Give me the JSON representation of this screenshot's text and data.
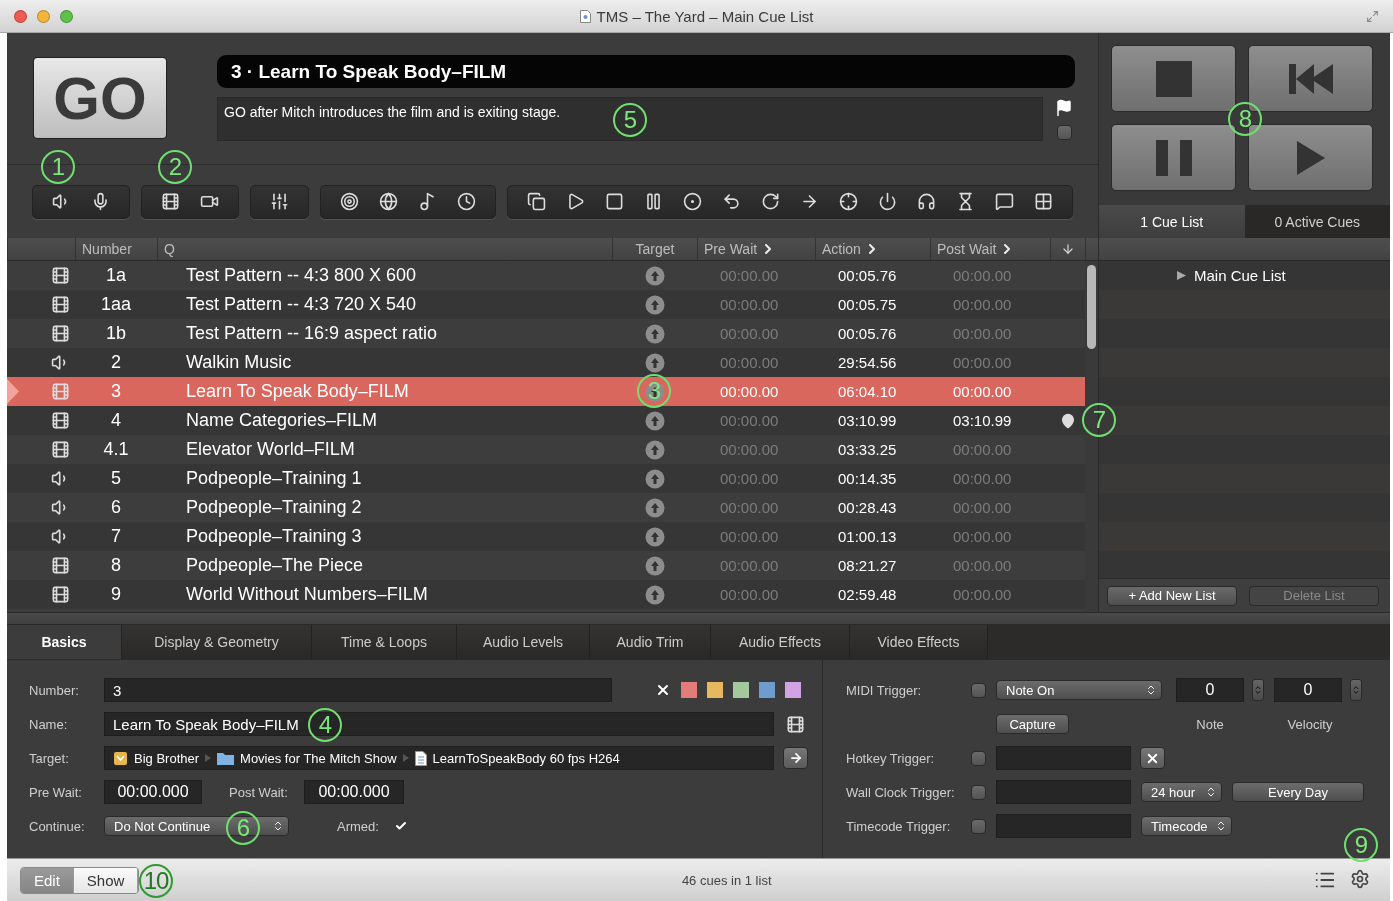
{
  "window": {
    "title": "TMS – The Yard – Main Cue List"
  },
  "go_button": {
    "label": "GO"
  },
  "current_cue": {
    "title": "3 · Learn To Speak Body–FILM",
    "notes": "GO after Mitch introduces the film and is exiting stage.",
    "flagged": false
  },
  "panel_tabs": [
    {
      "label": "1 Cue List",
      "selected": true
    },
    {
      "label": "0 Active Cues",
      "selected": false
    }
  ],
  "cue_lists": [
    {
      "name": "Main Cue List",
      "expanded": false
    }
  ],
  "list_buttons": [
    {
      "label": "+ Add New List",
      "disabled": false
    },
    {
      "label": "Delete List",
      "disabled": true
    }
  ],
  "table": {
    "columns": [
      {
        "label": "Number",
        "arrow": false
      },
      {
        "label": "Q",
        "arrow": false
      },
      {
        "label": "Target",
        "arrow": false
      },
      {
        "label": "Pre Wait",
        "arrow": true
      },
      {
        "label": "Action",
        "arrow": true
      },
      {
        "label": "Post Wait",
        "arrow": true
      }
    ],
    "rows": [
      {
        "kind": "video",
        "number": "1a",
        "q": "Test Pattern -- 4:3 800 X 600",
        "pre_wait": "00:00.00",
        "pre_wait_dim": true,
        "action": "00:05.76",
        "post_wait": "00:00.00",
        "post_wait_dim": true,
        "selected": false,
        "marker": false
      },
      {
        "kind": "video",
        "number": "1aa",
        "q": "Test Pattern -- 4:3 720 X 540",
        "pre_wait": "00:00.00",
        "pre_wait_dim": true,
        "action": "00:05.75",
        "post_wait": "00:00.00",
        "post_wait_dim": true,
        "selected": false,
        "marker": false
      },
      {
        "kind": "video",
        "number": "1b",
        "q": "Test Pattern -- 16:9 aspect ratio",
        "pre_wait": "00:00.00",
        "pre_wait_dim": true,
        "action": "00:05.76",
        "post_wait": "00:00.00",
        "post_wait_dim": true,
        "selected": false,
        "marker": false
      },
      {
        "kind": "audio",
        "number": "2",
        "q": "Walkin Music",
        "pre_wait": "00:00.00",
        "pre_wait_dim": true,
        "action": "29:54.56",
        "post_wait": "00:00.00",
        "post_wait_dim": true,
        "selected": false,
        "marker": false
      },
      {
        "kind": "video",
        "number": "3",
        "q": "Learn To Speak Body–FILM",
        "pre_wait": "00:00.00",
        "pre_wait_dim": false,
        "action": "06:04.10",
        "post_wait": "00:00.00",
        "post_wait_dim": false,
        "selected": true,
        "marker": false
      },
      {
        "kind": "video",
        "number": "4",
        "q": "Name Categories–FILM",
        "pre_wait": "00:00.00",
        "pre_wait_dim": true,
        "action": "03:10.99",
        "post_wait": "03:10.99",
        "post_wait_dim": false,
        "selected": false,
        "marker": true
      },
      {
        "kind": "video",
        "number": "4.1",
        "q": "Elevator World–FILM",
        "pre_wait": "00:00.00",
        "pre_wait_dim": true,
        "action": "03:33.25",
        "post_wait": "00:00.00",
        "post_wait_dim": true,
        "selected": false,
        "marker": false
      },
      {
        "kind": "audio",
        "number": "5",
        "q": "Podpeople–Training 1",
        "pre_wait": "00:00.00",
        "pre_wait_dim": true,
        "action": "00:14.35",
        "post_wait": "00:00.00",
        "post_wait_dim": true,
        "selected": false,
        "marker": false
      },
      {
        "kind": "audio",
        "number": "6",
        "q": "Podpeople–Training 2",
        "pre_wait": "00:00.00",
        "pre_wait_dim": true,
        "action": "00:28.43",
        "post_wait": "00:00.00",
        "post_wait_dim": true,
        "selected": false,
        "marker": false
      },
      {
        "kind": "audio",
        "number": "7",
        "q": "Podpeople–Training 3",
        "pre_wait": "00:00.00",
        "pre_wait_dim": true,
        "action": "01:00.13",
        "post_wait": "00:00.00",
        "post_wait_dim": true,
        "selected": false,
        "marker": false
      },
      {
        "kind": "video",
        "number": "8",
        "q": "Podpeople–The Piece",
        "pre_wait": "00:00.00",
        "pre_wait_dim": true,
        "action": "08:21.27",
        "post_wait": "00:00.00",
        "post_wait_dim": true,
        "selected": false,
        "marker": false
      },
      {
        "kind": "video",
        "number": "9",
        "q": "World Without Numbers–FILM",
        "pre_wait": "00:00.00",
        "pre_wait_dim": true,
        "action": "02:59.48",
        "post_wait": "00:00.00",
        "post_wait_dim": true,
        "selected": false,
        "marker": false
      }
    ]
  },
  "inspector_tabs": [
    {
      "label": "Basics",
      "selected": true
    },
    {
      "label": "Display & Geometry",
      "selected": false
    },
    {
      "label": "Time & Loops",
      "selected": false
    },
    {
      "label": "Audio Levels",
      "selected": false
    },
    {
      "label": "Audio Trim",
      "selected": false
    },
    {
      "label": "Audio Effects",
      "selected": false
    },
    {
      "label": "Video Effects",
      "selected": false
    }
  ],
  "basics": {
    "number": {
      "label": "Number:",
      "value": "3"
    },
    "colors": [
      {
        "color": "#e27c78"
      },
      {
        "color": "#e8b85c"
      },
      {
        "color": "#a3c99a"
      },
      {
        "color": "#6f9ccf"
      },
      {
        "color": "#d2a2e2"
      }
    ],
    "name": {
      "label": "Name:",
      "value": "Learn To Speak Body–FILM"
    },
    "target": {
      "label": "Target:",
      "path": [
        "Big Brother",
        "Movies for The Mitch Show",
        "LearnToSpeakBody 60 fps H264"
      ]
    },
    "pre_wait": {
      "label": "Pre Wait:",
      "value": "00:00.000"
    },
    "post_wait": {
      "label": "Post Wait:",
      "value": "00:00.000"
    },
    "continue": {
      "label": "Continue:",
      "value": "Do Not Continue"
    },
    "armed": {
      "label": "Armed:",
      "checked": true
    }
  },
  "triggers": {
    "midi": {
      "label": "MIDI Trigger:",
      "enabled": false,
      "message": "Note On",
      "note": "0",
      "velocity": "0",
      "capture": "Capture",
      "note_label": "Note",
      "velocity_label": "Velocity"
    },
    "hotkey": {
      "label": "Hotkey Trigger:",
      "enabled": false
    },
    "wall_clock": {
      "label": "Wall Clock Trigger:",
      "enabled": false,
      "format": "24 hour",
      "repeat": "Every Day"
    },
    "timecode": {
      "label": "Timecode Trigger:",
      "enabled": false,
      "source": "Timecode"
    }
  },
  "status_bar": {
    "modes": [
      {
        "label": "Edit",
        "selected": true
      },
      {
        "label": "Show",
        "selected": false
      }
    ],
    "summary": "46 cues in 1 list"
  },
  "callouts": [
    "1",
    "2",
    "3",
    "4",
    "5",
    "6",
    "7",
    "8",
    "9",
    "10"
  ]
}
